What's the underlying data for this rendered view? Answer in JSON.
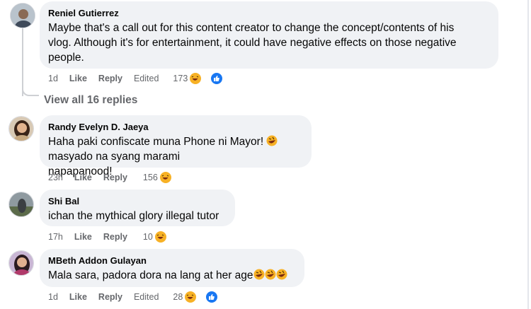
{
  "comments": [
    {
      "author": "Reniel Gutierrez",
      "lines": [
        "Maybe that's a call out for this content creator to change the concept/contents of his",
        "vlog. Although it's for entertainment, it could have negative effects on those negative",
        "people."
      ],
      "time": "1d",
      "like": "Like",
      "reply": "Reply",
      "edited": "Edited",
      "reaction_count": "173",
      "reactions": [
        "haha-emoji-icon",
        "like-emoji-icon"
      ]
    },
    {
      "author": "Randy Evelyn D. Jaeya",
      "lines": [
        "Haha paki confiscate muna Phone ni Mayor!",
        "masyado na syang marami",
        "napapanood!"
      ],
      "time": "23h",
      "like": "Like",
      "reply": "Reply",
      "reaction_count": "156",
      "reactions": [
        "haha-emoji-icon"
      ]
    },
    {
      "author": "Shi Bal",
      "lines": [
        "ichan the mythical glory illegal tutor"
      ],
      "time": "17h",
      "like": "Like",
      "reply": "Reply",
      "reaction_count": "10",
      "reactions": [
        "haha-emoji-icon"
      ]
    },
    {
      "author": "MBeth Addon Gulayan",
      "lines": [
        "Mala sara, padora dora na lang at her age"
      ],
      "time": "1d",
      "like": "Like",
      "reply": "Reply",
      "edited": "Edited",
      "reaction_count": "28",
      "reactions": [
        "haha-emoji-icon",
        "like-emoji-icon"
      ]
    }
  ],
  "view_all_replies": "View all 16 replies",
  "colors": {
    "bubble": "#f0f2f5",
    "meta": "#65676b",
    "haha": "#f7b125",
    "like": "#1877f2"
  }
}
